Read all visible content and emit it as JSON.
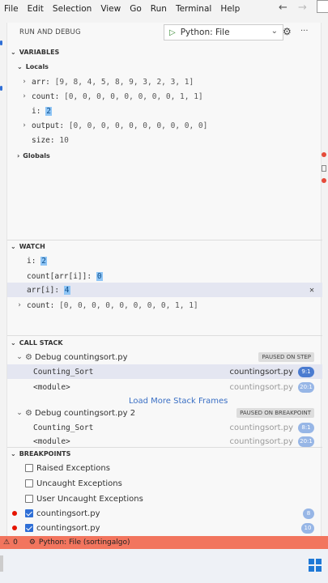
{
  "menubar": {
    "items": [
      "File",
      "Edit",
      "Selection",
      "View",
      "Go",
      "Run",
      "Terminal",
      "Help"
    ],
    "back": "←",
    "forward": "→"
  },
  "debug_header": {
    "title": "RUN AND DEBUG",
    "config": "Python: File",
    "gear": "⚙",
    "more": "···"
  },
  "variables": {
    "title": "VARIABLES",
    "locals_label": "Locals",
    "globals_label": "Globals",
    "locals": [
      {
        "name": "arr",
        "value": "[9, 8, 4, 5, 8, 9, 3, 2, 3, 1]"
      },
      {
        "name": "count",
        "value": "[0, 0, 0, 0, 0, 0, 0, 0, 1, 1]"
      },
      {
        "name": "i",
        "value": "2"
      },
      {
        "name": "output",
        "value": "[0, 0, 0, 0, 0, 0, 0, 0, 0, 0]"
      },
      {
        "name": "size",
        "value": "10"
      }
    ]
  },
  "watch": {
    "title": "WATCH",
    "items": [
      {
        "expr": "i",
        "value": "2"
      },
      {
        "expr": "count[arr[i]]",
        "value": "0"
      },
      {
        "expr": "arr[i]",
        "value": "4"
      },
      {
        "expr": "count",
        "value": "[0, 0, 0, 0, 0, 0, 0, 0, 1, 1]"
      }
    ],
    "close": "✕"
  },
  "callstack": {
    "title": "CALL STACK",
    "threads": [
      {
        "name": "Debug countingsort.py",
        "state": "PAUSED ON STEP",
        "frames": [
          {
            "func": "Counting_Sort",
            "file": "countingsort.py",
            "pos": "9:1"
          },
          {
            "func": "<module>",
            "file": "countingsort.py",
            "pos": "20:1"
          }
        ]
      },
      {
        "name": "Debug countingsort.py 2",
        "state": "PAUSED ON BREAKPOINT",
        "frames": [
          {
            "func": "Counting_Sort",
            "file": "countingsort.py",
            "pos": "8:1"
          },
          {
            "func": "<module>",
            "file": "countingsort.py",
            "pos": "20:1"
          }
        ]
      }
    ],
    "load_more": "Load More Stack Frames"
  },
  "breakpoints": {
    "title": "BREAKPOINTS",
    "items": [
      {
        "label": "Raised Exceptions",
        "checked": false
      },
      {
        "label": "Uncaught Exceptions",
        "checked": false
      },
      {
        "label": "User Uncaught Exceptions",
        "checked": false
      },
      {
        "label": "countingsort.py",
        "checked": true,
        "line": "8"
      },
      {
        "label": "countingsort.py",
        "checked": true,
        "line": "10"
      }
    ]
  },
  "statusbar": {
    "warnings": "0",
    "debug": "Python: File (sortingalgo)"
  },
  "colors": {
    "statusbar": "#f2755e",
    "accent": "#2f6fd6",
    "breakpoint": "#e51400"
  }
}
